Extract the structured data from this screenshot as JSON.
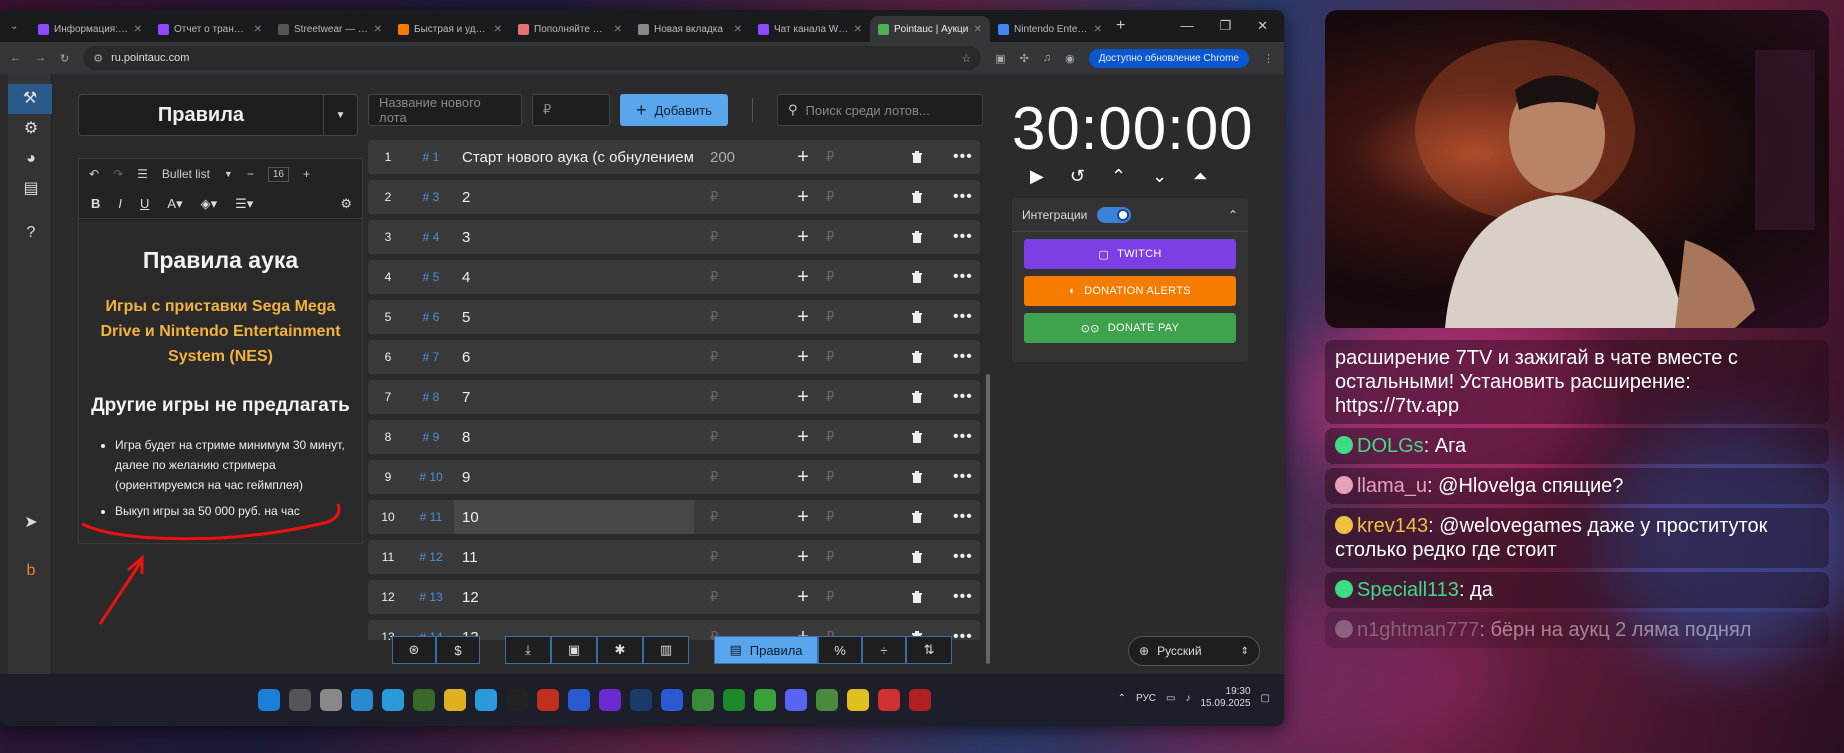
{
  "browser": {
    "tabs": [
      {
        "title": "Информация: W",
        "color": "#9146ff"
      },
      {
        "title": "Отчет о трансля",
        "color": "#9146ff"
      },
      {
        "title": "Streetwear — Inv",
        "color": "#555555"
      },
      {
        "title": "Быстрая и удобн",
        "color": "#f57c00"
      },
      {
        "title": "Пополняйте Stea",
        "color": "#e57373"
      },
      {
        "title": "Новая вкладка",
        "color": "#888888"
      },
      {
        "title": "Чат канала WEL",
        "color": "#9146ff"
      },
      {
        "title": "Pointauc | Аукци",
        "color": "#4caf50"
      },
      {
        "title": "Nintendo Enterta",
        "color": "#4285f4"
      }
    ],
    "url": "ru.pointauc.com",
    "update_label": "Доступно обновление Chrome"
  },
  "rules": {
    "title": "Правила",
    "toolbar_list": "Bullet list",
    "font_size": "16",
    "doc_title": "Правила аука",
    "doc_subtitle": "Игры с приставки Sega Mega Drive и Nintendo Entertainment System (NES)",
    "doc_heading2": "Другие игры не предлагать",
    "bullets": [
      "Игра будет на стриме минимум 30 минут, далее по желанию стримера (ориентируемся на час геймплея)",
      "Выкуп игры за 50 000 руб. на час"
    ]
  },
  "new_lot": {
    "name_placeholder": "Название нового лота",
    "sum_placeholder": "₽",
    "add_label": "Добавить",
    "search_placeholder": "Поиск среди лотов..."
  },
  "lots": [
    {
      "n": "1",
      "id": "# 1",
      "name": "Старт нового аука (с обнулением)",
      "sum": "200"
    },
    {
      "n": "2",
      "id": "# 3",
      "name": "2",
      "sum": "₽"
    },
    {
      "n": "3",
      "id": "# 4",
      "name": "3",
      "sum": "₽"
    },
    {
      "n": "4",
      "id": "# 5",
      "name": "4",
      "sum": "₽"
    },
    {
      "n": "5",
      "id": "# 6",
      "name": "5",
      "sum": "₽"
    },
    {
      "n": "6",
      "id": "# 7",
      "name": "6",
      "sum": "₽"
    },
    {
      "n": "7",
      "id": "# 8",
      "name": "7",
      "sum": "₽"
    },
    {
      "n": "8",
      "id": "# 9",
      "name": "8",
      "sum": "₽"
    },
    {
      "n": "9",
      "id": "# 10",
      "name": "9",
      "sum": "₽"
    },
    {
      "n": "10",
      "id": "# 11",
      "name": "10",
      "sum": "₽"
    },
    {
      "n": "11",
      "id": "# 12",
      "name": "11",
      "sum": "₽"
    },
    {
      "n": "12",
      "id": "# 13",
      "name": "12",
      "sum": "₽"
    },
    {
      "n": "13",
      "id": "# 14",
      "name": "13",
      "sum": "₽"
    }
  ],
  "rub": "₽",
  "timer": "30:00:00",
  "integrations": {
    "label": "Интеграции",
    "twitch": "TWITCH",
    "donation_alerts": "DONATION ALERTS",
    "donate_pay": "DONATE PAY",
    "colors": {
      "twitch": "#7b3fe4",
      "donation_alerts": "#f57c00",
      "donate_pay": "#3fa34d"
    }
  },
  "bottom": {
    "rules_tab": "Правила",
    "language": "Русский"
  },
  "taskbar": {
    "lang": "РУС",
    "time": "19:30",
    "date": "15.09.2025"
  },
  "chat": [
    {
      "user": "",
      "text": "расширение 7TV и зажигай в чате вместе с остальными! Установить расширение: https://7tv.app",
      "color": "#ffffff"
    },
    {
      "user": "DOLGs",
      "text": ": Ага",
      "color": "#3ddc84"
    },
    {
      "user": "llama_u",
      "text": ": @Hlovelga спящие?",
      "color": "#e8a0b8"
    },
    {
      "user": "krev143",
      "text": ": @welovegames даже у проституток столько редко где стоит",
      "color": "#f0c040"
    },
    {
      "user": "Speciall113",
      "text": ": да",
      "color": "#3ddc84"
    },
    {
      "user": "n1ghtman777",
      "text": ": бёрн на аукц 2 ляма поднял",
      "color": "#aaaaaa"
    }
  ]
}
